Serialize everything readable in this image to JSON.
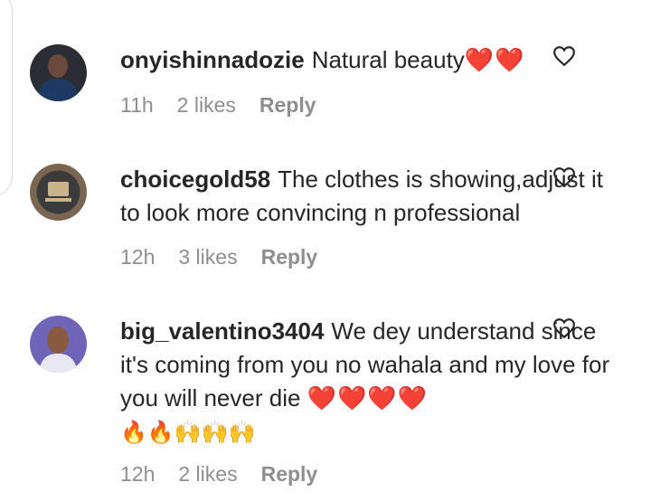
{
  "comments": [
    {
      "username": "onyishinnadozie",
      "text": "Natural beauty",
      "emoji": "❤️❤️",
      "emoji2": "",
      "time": "11h",
      "likes": "2 likes",
      "reply_label": "Reply"
    },
    {
      "username": "choicegold58",
      "text": "The clothes is showing,adjust it to look more convincing n professional",
      "emoji": "",
      "emoji2": "",
      "time": "12h",
      "likes": "3 likes",
      "reply_label": "Reply"
    },
    {
      "username": "big_valentino3404",
      "text": "We dey understand since it's coming from you no wahala and my love for you will never die",
      "emoji": "❤️❤️❤️❤️",
      "emoji2": "🔥🔥🙌🙌🙌",
      "time": "12h",
      "likes": "2 likes",
      "reply_label": "Reply"
    }
  ],
  "colors": {
    "text": "#262626",
    "meta": "#8e8e8e",
    "heart": "#e0152b"
  },
  "icons": {
    "like": "heart-outline-icon"
  }
}
